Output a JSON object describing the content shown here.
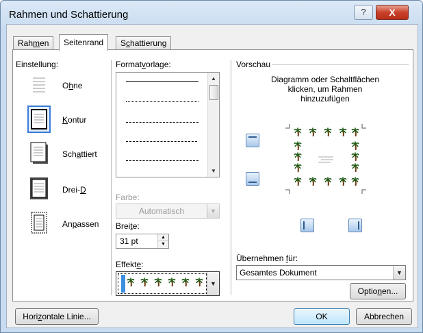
{
  "window": {
    "title": "Rahmen und Schattierung",
    "help": "?",
    "close": "X"
  },
  "tabs": [
    {
      "label": "Rahmen",
      "hot": "m",
      "pre": "Rah",
      "post": "en"
    },
    {
      "label": "Seitenrand"
    },
    {
      "label": "Schattierung",
      "pre": "S",
      "hot": "c",
      "post": "hattierung"
    }
  ],
  "einstellung": {
    "header": "Einstellung:",
    "items": [
      {
        "pre": "O",
        "hot": "h",
        "post": "ne"
      },
      {
        "pre": "",
        "hot": "K",
        "post": "ontur"
      },
      {
        "pre": "Sch",
        "hot": "a",
        "post": "ttiert"
      },
      {
        "pre": "Drei-",
        "hot": "D",
        "post": ""
      },
      {
        "pre": "An",
        "hot": "p",
        "post": "assen"
      }
    ]
  },
  "formatvorlage": {
    "pre": "Format",
    "hot": "v",
    "post": "orlage:"
  },
  "farbe": {
    "label": "Farbe:",
    "value": "Automatisch"
  },
  "breite": {
    "pre": "Brei",
    "hot": "t",
    "post": "e:",
    "value": "31 pt"
  },
  "effekte": {
    "pre": "Effekt",
    "hot": "e",
    "post": ":"
  },
  "vorschau": {
    "header": "Vorschau",
    "hint": [
      "Diagramm oder Schaltflächen",
      "klicken, um Rahmen",
      "hinzuzufügen"
    ]
  },
  "uebernehmen": {
    "pre": "Übernehmen ",
    "hot": "f",
    "post": "ür:",
    "value": "Gesamtes Dokument"
  },
  "buttons": {
    "optionen": {
      "pre": "Optio",
      "hot": "n",
      "post": "en..."
    },
    "horizontale": {
      "pre": "Hori",
      "hot": "z",
      "post": "ontale Linie..."
    },
    "ok": "OK",
    "abbrechen": "Abbrechen"
  },
  "colors": {
    "selection": "#3a7bd5",
    "palm_leaf": "#1f5a14",
    "palm_trunk": "#6b3d12",
    "effect_bg": "#3d8fe0"
  }
}
